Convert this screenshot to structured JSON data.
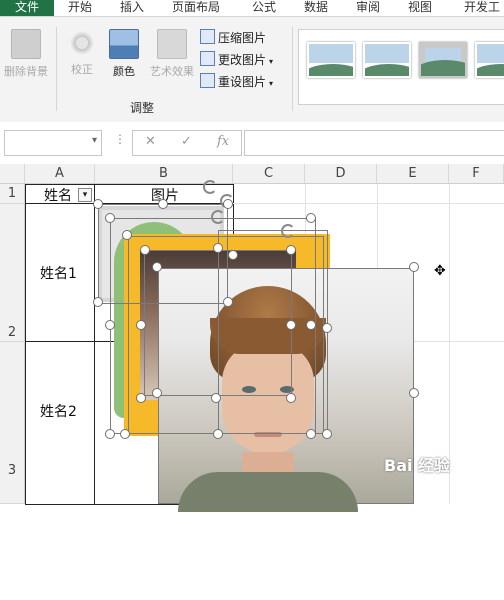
{
  "tabs": [
    "文件",
    "开始",
    "插入",
    "页面布局",
    "公式",
    "数据",
    "审阅",
    "视图",
    "开发工"
  ],
  "ribbon": {
    "remove_bg": "删除背景",
    "correct": "校正",
    "color": "颜色",
    "art_effect": "艺术效果",
    "compress": "压缩图片",
    "change": "更改图片",
    "reset": "重设图片",
    "group_label": "调整"
  },
  "formula_bar": {
    "fx": "fx",
    "cancel": "✕",
    "enter": "✓",
    "dots": "⋮"
  },
  "columns": [
    "A",
    "B",
    "C",
    "D",
    "E",
    "F"
  ],
  "rows": [
    "1",
    "2",
    "3"
  ],
  "cells": {
    "a1": "姓名",
    "b1": "图片",
    "a2": "姓名1",
    "a3": "姓名2"
  },
  "filter_arrow": "▾",
  "watermark": "Bai 经验",
  "colors": {
    "file_tab": "#217346",
    "picture_border_yellow": "#f6b92a",
    "handle_border": "#6f6f6f"
  },
  "icons": [
    "remove-background-icon",
    "correct-icon",
    "color-icon",
    "art-effect-icon",
    "compress-icon",
    "change-picture-icon",
    "reset-picture-icon",
    "move-cursor-icon"
  ]
}
